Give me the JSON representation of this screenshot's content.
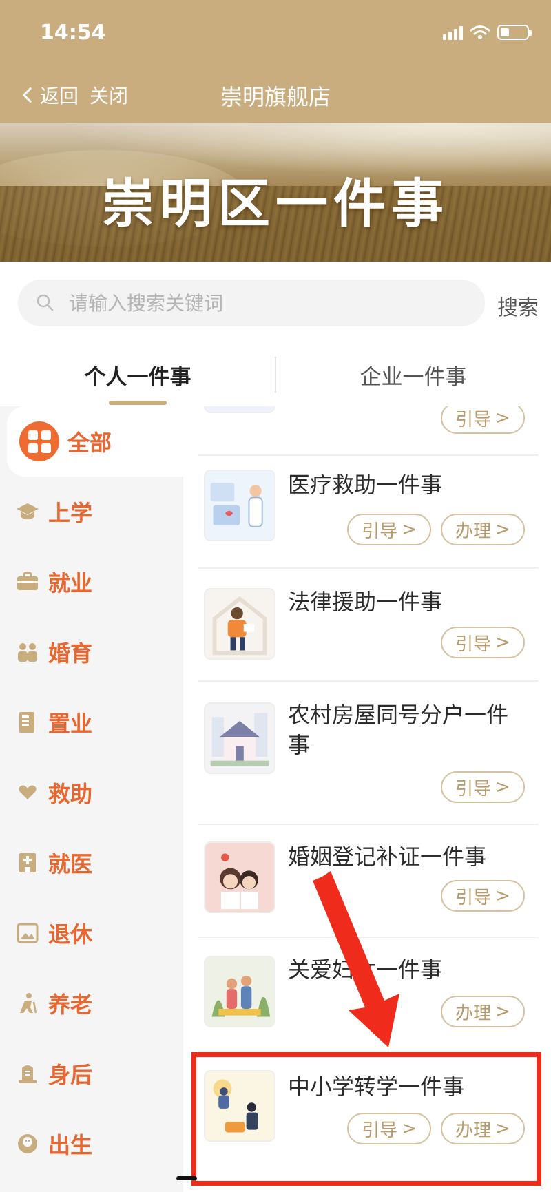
{
  "status_bar": {
    "time": "14:54"
  },
  "nav": {
    "back_label": "返回",
    "close_label": "关闭",
    "title": "崇明旗舰店"
  },
  "banner": {
    "title": "崇明区一件事"
  },
  "search": {
    "placeholder": "请输入搜索关键词",
    "button_label": "搜索"
  },
  "tabs": [
    {
      "label": "个人一件事",
      "active": true
    },
    {
      "label": "企业一件事",
      "active": false
    }
  ],
  "sidebar": {
    "items": [
      {
        "label": "全部",
        "icon": "grid-icon",
        "active": true
      },
      {
        "label": "上学",
        "icon": "graduation-cap-icon"
      },
      {
        "label": "就业",
        "icon": "briefcase-icon"
      },
      {
        "label": "婚育",
        "icon": "couple-icon"
      },
      {
        "label": "置业",
        "icon": "building-doc-icon"
      },
      {
        "label": "救助",
        "icon": "heart-hand-icon"
      },
      {
        "label": "就医",
        "icon": "hospital-icon"
      },
      {
        "label": "退休",
        "icon": "picture-frame-icon"
      },
      {
        "label": "养老",
        "icon": "elderly-icon"
      },
      {
        "label": "身后",
        "icon": "memorial-icon"
      },
      {
        "label": "出生",
        "icon": "baby-icon"
      }
    ]
  },
  "list": {
    "guide_label": "引导",
    "handle_label": "办理",
    "items": [
      {
        "title": "医疗救助一件事",
        "thumb": "medical-illustration",
        "actions": [
          "guide",
          "handle"
        ]
      },
      {
        "title": "法律援助一件事",
        "thumb": "legal-aid-illustration",
        "actions": [
          "guide"
        ]
      },
      {
        "title": "农村房屋同号分户一件事",
        "thumb": "house-illustration",
        "actions": [
          "guide"
        ]
      },
      {
        "title": "婚姻登记补证一件事",
        "thumb": "marriage-illustration",
        "actions": [
          "guide"
        ]
      },
      {
        "title": "关爱妇女一件事",
        "thumb": "women-care-illustration",
        "actions": [
          "handle"
        ]
      },
      {
        "title": "中小学转学一件事",
        "thumb": "school-transfer-illustration",
        "actions": [
          "guide",
          "handle"
        ]
      }
    ]
  },
  "colors": {
    "header": "#c9ad7f",
    "accent_orange": "#e8662f",
    "pill_border": "#d5c2a2",
    "highlight_red": "#ef2b1c"
  }
}
